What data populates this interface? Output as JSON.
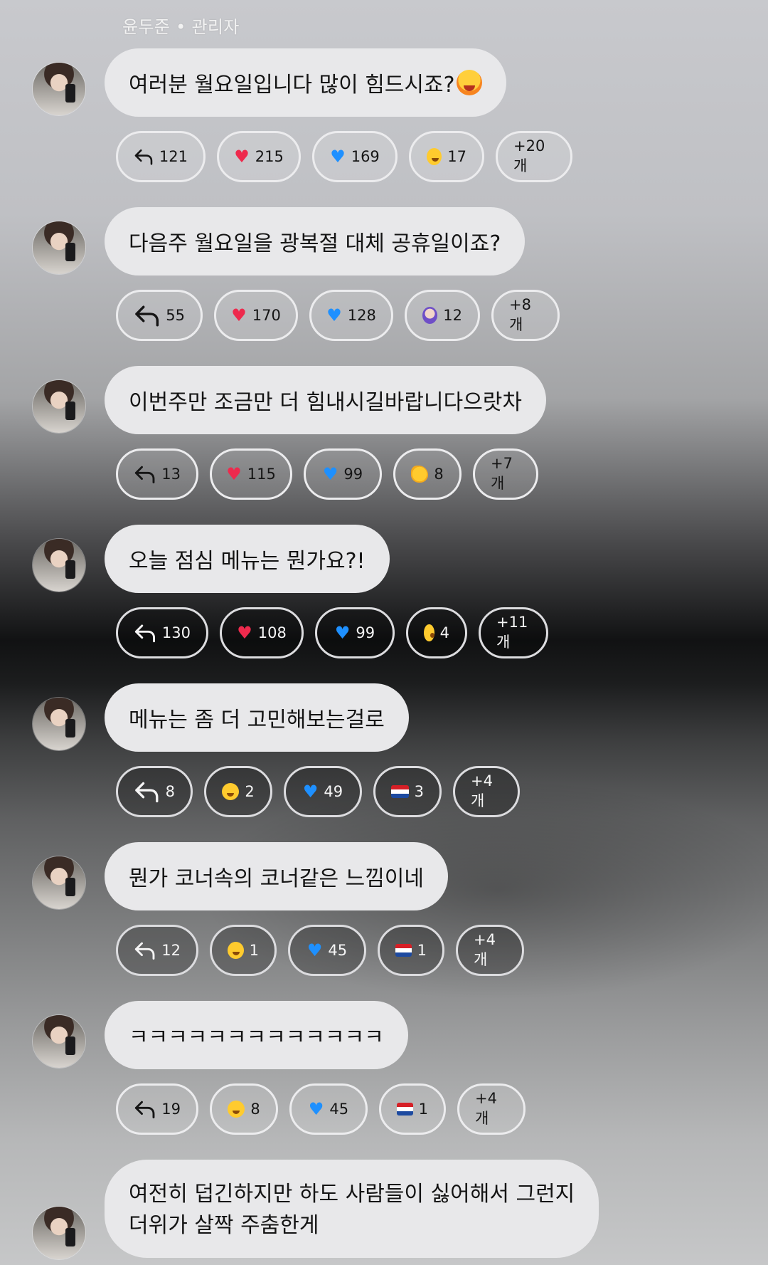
{
  "sender": "윤두준 • 관리자",
  "colors": {
    "bubble_bg": "#e8e8ea",
    "heart_red": "#ee2a4d",
    "heart_blue": "#1e90ff"
  },
  "messages": [
    {
      "text": "여러분 월요일입니다 많이 힘드시죠?",
      "emoji": "hot-face",
      "reply": "121",
      "reactions": [
        {
          "icon": "red-heart",
          "count": "215"
        },
        {
          "icon": "blue-heart",
          "count": "169"
        },
        {
          "icon": "pleading-face",
          "count": "17"
        }
      ],
      "more": "+20개"
    },
    {
      "text": "다음주 월요일을 광복절 대체 공휴일이죠?",
      "reply": "55",
      "reactions": [
        {
          "icon": "red-heart",
          "count": "170"
        },
        {
          "icon": "blue-heart",
          "count": "128"
        },
        {
          "icon": "person-face",
          "count": "12"
        }
      ],
      "more": "+8개"
    },
    {
      "text": "이번주만 조금만 더 힘내시길바랍니다으랏차",
      "reply": "13",
      "reactions": [
        {
          "icon": "red-heart",
          "count": "115"
        },
        {
          "icon": "blue-heart",
          "count": "99"
        },
        {
          "icon": "clapping-hands",
          "count": "8"
        }
      ],
      "more": "+7개"
    },
    {
      "text": "오늘 점심 메뉴는 뭔가요?!",
      "reply": "130",
      "reactions": [
        {
          "icon": "red-heart",
          "count": "108"
        },
        {
          "icon": "blue-heart",
          "count": "99"
        },
        {
          "icon": "surprised-face",
          "count": "4"
        }
      ],
      "more": "+11개"
    },
    {
      "text": "메뉴는 좀 더 고민해보는걸로",
      "reply": "8",
      "reactions": [
        {
          "icon": "laughing-face",
          "count": "2"
        },
        {
          "icon": "blue-heart",
          "count": "49"
        },
        {
          "icon": "netherlands-flag",
          "count": "3"
        }
      ],
      "more": "+4개"
    },
    {
      "text": "뭔가 코너속의 코너같은 느낌이네",
      "reply": "12",
      "reactions": [
        {
          "icon": "laughing-face",
          "count": "1"
        },
        {
          "icon": "blue-heart",
          "count": "45"
        },
        {
          "icon": "netherlands-flag",
          "count": "1"
        }
      ],
      "more": "+4개"
    },
    {
      "text": "ㅋㅋㅋㅋㅋㅋㅋㅋㅋㅋㅋㅋㅋ",
      "reply": "19",
      "reactions": [
        {
          "icon": "laughing-face",
          "count": "8"
        },
        {
          "icon": "blue-heart",
          "count": "45"
        },
        {
          "icon": "netherlands-flag",
          "count": "1"
        }
      ],
      "more": "+4개"
    },
    {
      "text_line1": "여전히 덥긴하지만 하도 사람들이 싫어해서 그런지",
      "text_line2": "더위가 살짝 주춤한게"
    }
  ]
}
